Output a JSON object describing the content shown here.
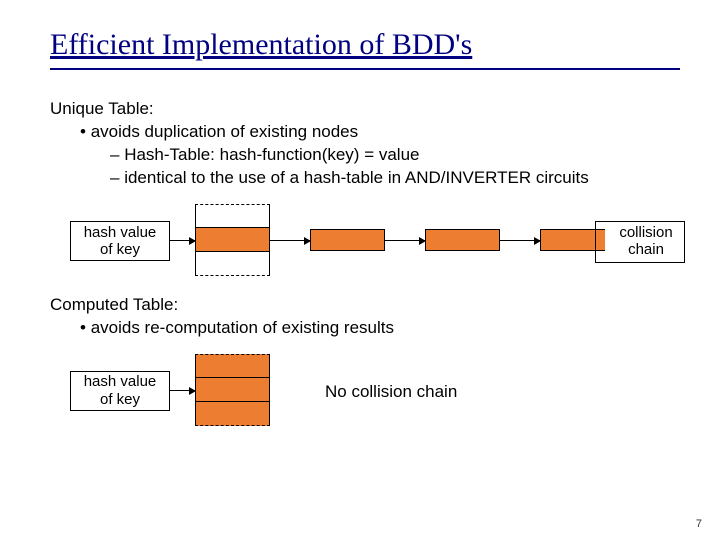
{
  "title": "Efficient Implementation of BDD's",
  "section1": {
    "heading": "Unique Table:",
    "bullet": "avoids duplication of existing nodes",
    "sub1": "Hash-Table: hash-function(key) = value",
    "sub2": "identical to the use of a hash-table in AND/INVERTER circuits"
  },
  "section2": {
    "heading": "Computed Table:",
    "bullet": "avoids re-computation of existing results"
  },
  "labels": {
    "hash_value_line1": "hash value",
    "hash_value_line2": "of key",
    "collision_line1": "collision",
    "collision_line2": "chain",
    "no_collision": "No collision chain"
  },
  "page_number": "7"
}
